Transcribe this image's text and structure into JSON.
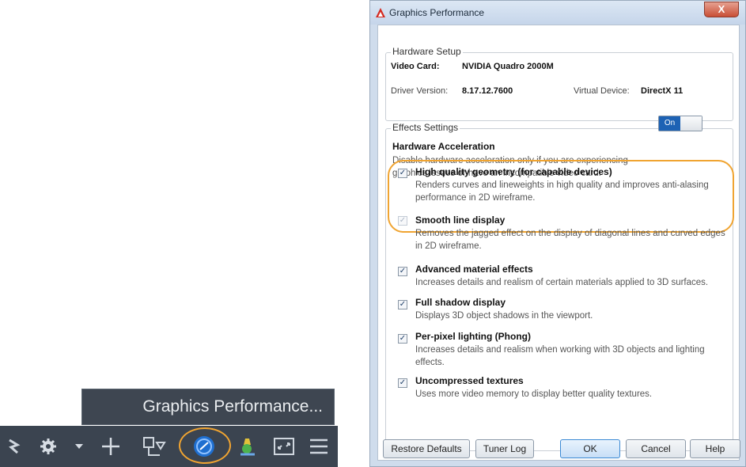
{
  "tooltip": {
    "text": "Graphics Performance..."
  },
  "statusbar": {
    "icons": [
      "snap-icon",
      "gear-icon",
      "dropdown-icon",
      "plus-icon",
      "selection-icon",
      "graphics-performance-icon",
      "isolate-icon",
      "fullscreen-icon",
      "menu-icon"
    ],
    "highlight_color": "#f0a431"
  },
  "dialog": {
    "title": "Graphics Performance",
    "close": "X",
    "hardware_setup": {
      "label": "Hardware Setup",
      "video_card_label": "Video Card:",
      "video_card_value": "NVIDIA Quadro 2000M",
      "driver_label": "Driver Version:",
      "driver_value": "8.17.12.7600",
      "virtual_device_label": "Virtual Device:",
      "virtual_device_value": "DirectX 11"
    },
    "effects": {
      "label": "Effects Settings",
      "hw_accel_title": "Hardware Acceleration",
      "hw_accel_desc": "Disable hardware acceleration only if you are experiencing graphics issues or have an incompatible video card.",
      "toggle_label": "On",
      "settings": [
        {
          "title": "High quality geometry (for capable devices)",
          "desc": "Renders curves and lineweights in high quality and improves anti-alasing performance in 2D wireframe.",
          "checked": true,
          "enabled": true
        },
        {
          "title": "Smooth line display",
          "desc": "Removes the jagged effect on the display of diagonal lines and curved edges in 2D wireframe.",
          "checked": true,
          "enabled": false
        },
        {
          "title": "Advanced material effects",
          "desc": "Increases details and realism of certain materials applied to 3D surfaces.",
          "checked": true,
          "enabled": true
        },
        {
          "title": "Full shadow display",
          "desc": "Displays 3D object shadows in the viewport.",
          "checked": true,
          "enabled": true
        },
        {
          "title": "Per-pixel lighting (Phong)",
          "desc": "Increases details and realism when working with 3D objects and lighting effects.",
          "checked": true,
          "enabled": true
        },
        {
          "title": "Uncompressed textures",
          "desc": "Uses more video memory to display better quality textures.",
          "checked": true,
          "enabled": true
        }
      ]
    },
    "buttons": {
      "restore": "Restore Defaults",
      "tuner_log": "Tuner Log",
      "ok": "OK",
      "cancel": "Cancel",
      "help": "Help"
    },
    "check_glyph": "✓"
  }
}
